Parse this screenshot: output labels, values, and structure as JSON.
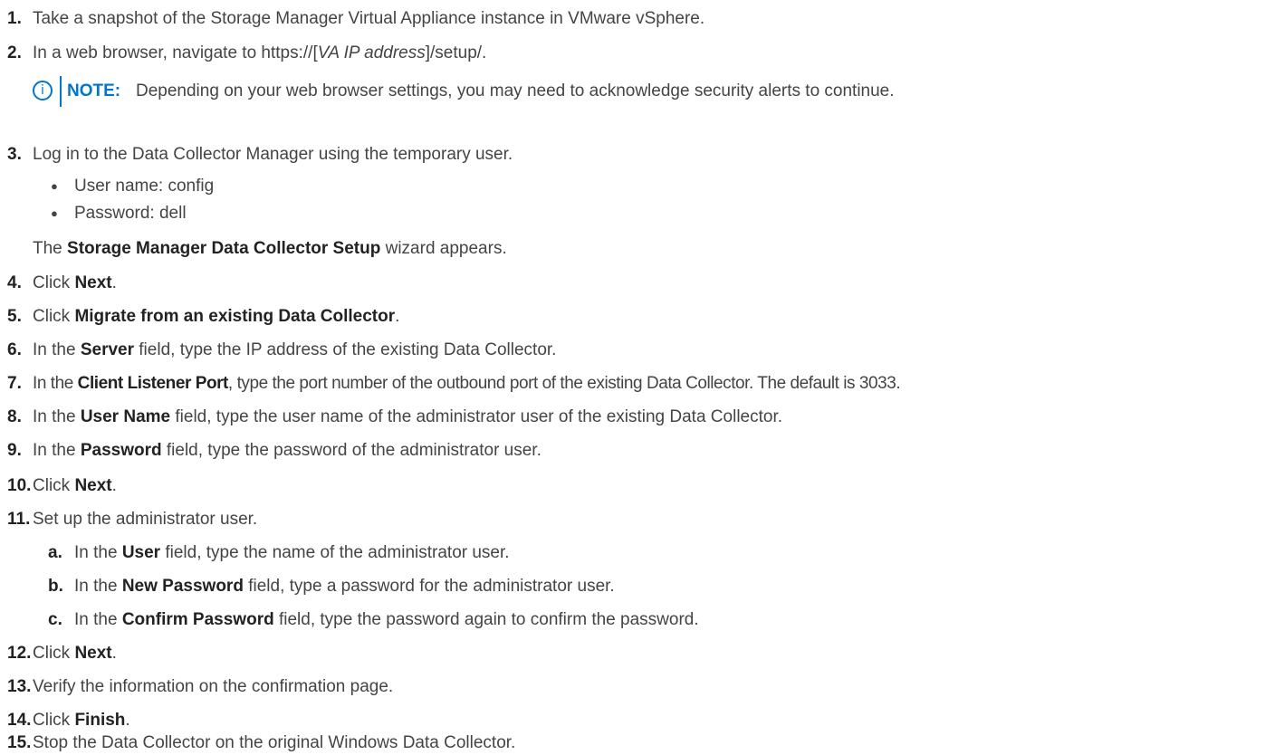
{
  "steps": [
    {
      "num": "1.",
      "text": "Take a snapshot of the Storage Manager Virtual Appliance instance in VMware vSphere."
    },
    {
      "num": "2.",
      "pre": "In a web browser, navigate to https://[",
      "italic": "VA IP address",
      "post": "]/setup/."
    },
    {
      "num": "3.",
      "text": "Log in to the Data Collector Manager using the temporary user."
    },
    {
      "num": "4.",
      "pre": "Click ",
      "bold": "Next",
      "post": "."
    },
    {
      "num": "5.",
      "pre": "Click ",
      "bold": "Migrate from an existing Data Collector",
      "post": "."
    },
    {
      "num": "6.",
      "pre": "In the ",
      "bold": "Server",
      "post": " field, type the IP address of the existing Data Collector."
    },
    {
      "num": "7.",
      "pre": "In the ",
      "bold": "Client Listener Port",
      "post": ", type the port number of the outbound port of the existing Data Collector. The default is 3033."
    },
    {
      "num": "8.",
      "pre": "In the ",
      "bold": "User Name",
      "post": " field, type the user name of the administrator user of the existing Data Collector."
    },
    {
      "num": "9.",
      "pre": "In the ",
      "bold": "Password",
      "post": " field, type the password of the administrator user."
    },
    {
      "num": "10.",
      "pre": "Click ",
      "bold": "Next",
      "post": "."
    },
    {
      "num": "11.",
      "text": "Set up the administrator user."
    },
    {
      "num": "12.",
      "pre": "Click ",
      "bold": "Next",
      "post": "."
    },
    {
      "num": "13.",
      "text": "Verify the information on the confirmation page."
    },
    {
      "num": "14.",
      "pre": "Click ",
      "bold": "Finish",
      "post": "."
    },
    {
      "num": "15.",
      "text": "Stop the Data Collector on the original Windows Data Collector."
    }
  ],
  "note": {
    "icon": "info-circle-icon",
    "icon_glyph": "i",
    "label": "NOTE:",
    "text": "Depending on your web browser settings, you may need to acknowledge security alerts to continue."
  },
  "login_bullets": [
    "User name: config",
    "Password: dell"
  ],
  "wizard_line": {
    "pre": "The ",
    "bold": "Storage Manager Data Collector Setup",
    "post": " wizard appears."
  },
  "substeps": [
    {
      "letter": "a.",
      "pre": "In the ",
      "bold": "User",
      "post": " field, type the name of the administrator user."
    },
    {
      "letter": "b.",
      "pre": "In the ",
      "bold": "New Password",
      "post": " field, type a password for the administrator user."
    },
    {
      "letter": "c.",
      "pre": "In the ",
      "bold": "Confirm Password",
      "post": " field, type the password again to confirm the password."
    }
  ],
  "colors": {
    "accent": "#0076ce",
    "text": "#444444",
    "bold": "#222222"
  }
}
